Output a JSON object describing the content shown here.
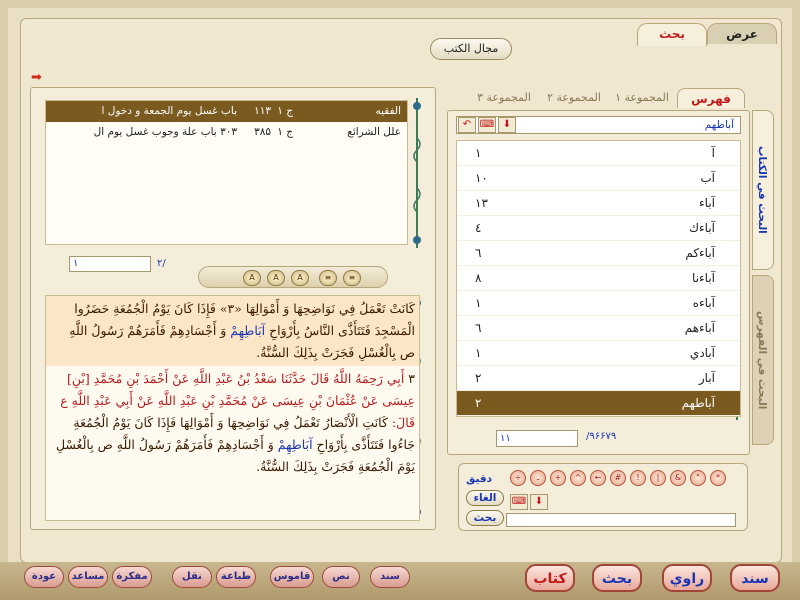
{
  "tabs": {
    "view": "عرض",
    "search": "بحث"
  },
  "domain_button": "مجال الكتب",
  "results": {
    "rows": [
      {
        "book": "الفقيه",
        "vol": "ج ۱",
        "page": "۱۱۳",
        "title": "باب غسل يوم الجمعة و دخول ا",
        "selected": true
      },
      {
        "book": "علل الشرائع",
        "vol": "ج ۱",
        "page": "۳۸۵",
        "title": "۳۰۳ باب علة وجوب غسل يوم ال",
        "selected": false
      }
    ],
    "page_current": "۱",
    "page_total": "/۲"
  },
  "text": {
    "p1": "كَانَتْ تَعْمَلُ فِي نَوَاضِحِهَا وَ أَمْوَالِهَا «۳» فَإِذَا كَانَ يَوْمُ الْجُمُعَةِ حَضَرُوا الْمَسْجِدَ فَتَتَأَذَّى النَّاسُ بِأَرْوَاحِ",
    "p1_hl1": "آبَاطِهِمْ",
    "p1_b": "وَ أَجْسَادِهِمْ فَأَمَرَهُمْ رَسُولُ اللَّهِ ص بِالْغُسْلِ فَجَرَتْ بِذَلِكَ السُّنَّةُ.",
    "p2_num": "۳",
    "p2_red": "أَبِي رَحِمَهُ اللَّهُ قَالَ حَدَّثَنَا سَعْدُ بْنُ عَبْدِ اللَّهِ عَنْ أَحْمَدَ بْنِ مُحَمَّدِ [بْنِ] عِيسَى عَنْ عُثْمَانَ بْنِ عِيسَى عَنْ مُحَمَّدِ بْنِ عَبْدِ اللَّهِ عَنْ أَبِي عَبْدِ اللَّهِ ع قَالَ:",
    "p2": "كَانَتِ الْأَنْصَارُ تَعْمَلُ فِي نَوَاضِحِهَا وَ أَمْوَالِهَا فَإِذَا كَانَ يَوْمُ الْجُمُعَةِ جَاءُوا فَتَتَأَذَّى بِأَرْوَاحِ",
    "p2_hl": "آبَاطِهِمْ",
    "p2_b": "وَ أَجْسَادِهِمْ فَأَمَرَهُمْ رَسُولُ اللَّهِ ص بِالْغُسْلِ يَوْمَ الْجُمُعَةِ فَجَرَتْ بِذَلِكَ السُّنَّةُ."
  },
  "index": {
    "tab_index": "فهرس",
    "tab_group1": "المجموعة ۱",
    "tab_group2": "المجموعة ۲",
    "tab_group3": "المجموعة ۳",
    "vtab_book": "البحث في الكتاب",
    "vtab_index": "البحث في الفهرس",
    "word": "آباطهم",
    "items": [
      {
        "word": "آ",
        "count": "۱",
        "selected": false
      },
      {
        "word": "آب",
        "count": "۱۰",
        "selected": false
      },
      {
        "word": "آباء",
        "count": "۱۳",
        "selected": false
      },
      {
        "word": "آباءك",
        "count": "٤",
        "selected": false
      },
      {
        "word": "آباءكم",
        "count": "٦",
        "selected": false
      },
      {
        "word": "آباءنا",
        "count": "۸",
        "selected": false
      },
      {
        "word": "آباءه",
        "count": "۱",
        "selected": false
      },
      {
        "word": "آباءهم",
        "count": "٦",
        "selected": false
      },
      {
        "word": "آبادي",
        "count": "۱",
        "selected": false
      },
      {
        "word": "آبار",
        "count": "۲",
        "selected": false
      },
      {
        "word": "آباطهم",
        "count": "۲",
        "selected": true
      }
    ],
    "page_current": "۱۱",
    "page_total": "/۹۶۶۷۹"
  },
  "query": {
    "exact": "دقيق",
    "cancel": "الغاء",
    "search": "بحث"
  },
  "bottom": {
    "back": "عودة",
    "helper": "مساعد",
    "notes": "مفكرة",
    "transfer": "نقل",
    "print": "طباعة",
    "dictionary": "قاموس",
    "text": "نص",
    "sanad": "سند",
    "book": "كتاب",
    "search": "بحث",
    "narrator": "راوي",
    "sanad2": "سند"
  }
}
